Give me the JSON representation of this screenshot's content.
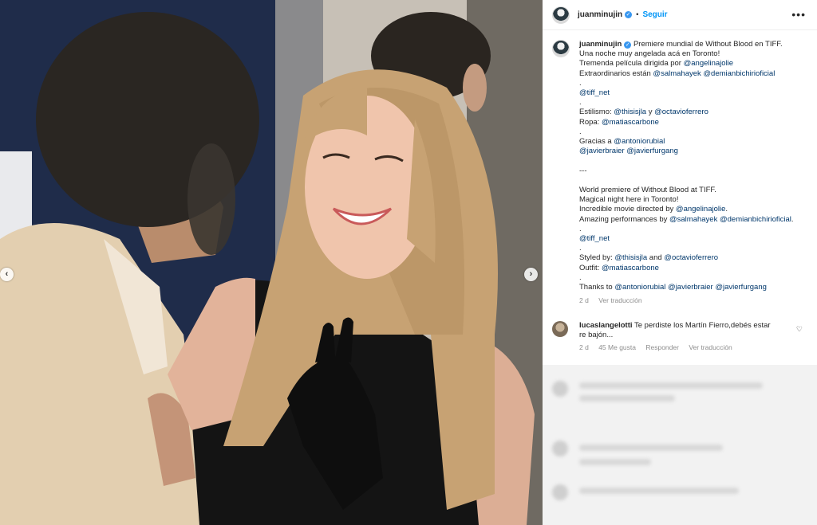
{
  "header": {
    "username": "juanminujin",
    "verified_icon": "verified-badge-icon",
    "follow_label": "Seguir",
    "separator": "•",
    "more_label": "•••"
  },
  "caption": {
    "username": "juanminujin",
    "lines": [
      "Premiere mundial de Without Blood en TIFF.",
      "Una noche muy angelada acá en Toronto!",
      "Tremenda película dirigida por @angelinajolie",
      "Extraordinarios están @salmahayek @demianbichirioficial",
      ".",
      "@tiff_net",
      ".",
      "Estilismo: @thisisjla y @octavioferrero",
      "Ropa: @matiascarbone",
      ".",
      "Gracias a @antoniorubial",
      "@javierbraier @javierfurgang",
      "",
      "---",
      "",
      "World premiere of Without Blood at TIFF.",
      "Magical night here in Toronto!",
      "Incredible movie directed by @angelinajolie.",
      "Amazing performances by @salmahayek @demianbichirioficial.",
      ".",
      "@tiff_net",
      ".",
      "Styled by: @thisisjla and @octavioferrero",
      "Outfit: @matiascarbone",
      ".",
      "Thanks to @antoniorubial @javierbraier @javierfurgang"
    ],
    "time": "2 d",
    "translate_label": "Ver traducción"
  },
  "comment": {
    "username": "lucaslangelotti",
    "text": "Te perdiste los Martín Fierro,debés estar re bajón...",
    "time": "2 d",
    "likes": "45 Me gusta",
    "reply_label": "Responder",
    "translate_label": "Ver traducción",
    "heart_icon": "heart-outline-icon"
  },
  "media": {
    "prev_label": "‹",
    "next_label": "›"
  },
  "colors": {
    "accent": "#0095f6",
    "mention": "#00376b",
    "muted": "#8e8e8e"
  }
}
